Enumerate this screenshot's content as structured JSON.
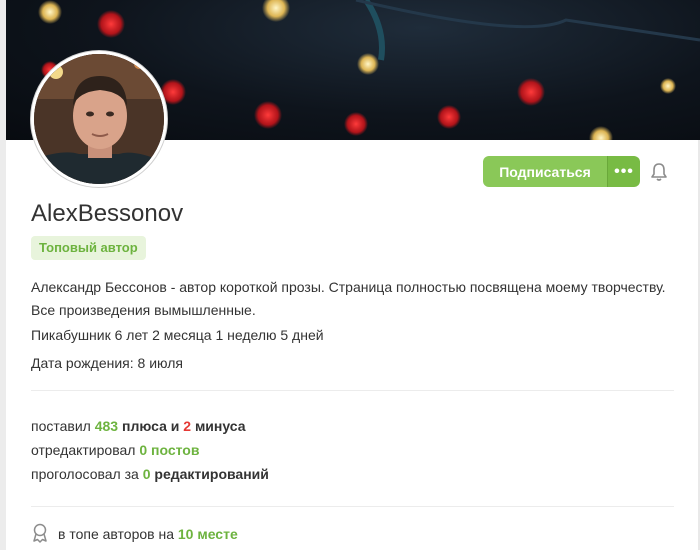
{
  "profile": {
    "username": "AlexBessonov",
    "badge": "Топовый автор",
    "about": "Александр Бессонов - автор короткой прозы. Страница полностью посвящена моему творчеству. Все произведения вымышленные.",
    "membership": "Пикабушник 6 лет 2 месяца 1 неделю 5 дней",
    "birthday": "Дата рождения: 8 июля"
  },
  "actions": {
    "subscribe_label": "Подписаться",
    "more_label": "•••"
  },
  "stats": {
    "votes_prefix": "поставил",
    "plus_count": "483",
    "plus_word": "плюса и",
    "minus_count": "2",
    "minus_word": "минуса",
    "edited_prefix": "отредактировал",
    "edited_count": "0 постов",
    "voted_prefix": "проголосовал за",
    "voted_count": "0",
    "voted_word": "редактирований"
  },
  "rank": {
    "prefix": "в топе авторов на",
    "place": "10 месте"
  },
  "icons": {
    "bell": "bell-icon",
    "rank": "award-icon",
    "more": "more-dots-icon"
  },
  "colors": {
    "accent_green": "#8ac858",
    "stat_green": "#6db33f",
    "stat_red": "#e53935",
    "badge_bg": "#e8f4dc"
  }
}
